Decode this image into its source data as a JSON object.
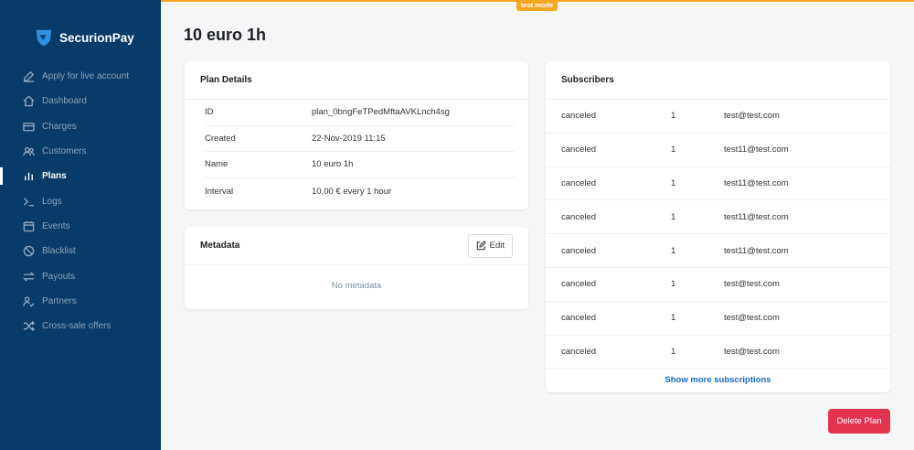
{
  "app": {
    "brand": "SecurionPay",
    "mode_badge": "test mode",
    "accent": "#f5a623",
    "sidebar_bg": "#063b6a"
  },
  "sidebar": {
    "items": [
      {
        "label": "Apply for live account",
        "icon": "edit-icon"
      },
      {
        "label": "Dashboard",
        "icon": "home-icon"
      },
      {
        "label": "Charges",
        "icon": "card-icon"
      },
      {
        "label": "Customers",
        "icon": "users-icon"
      },
      {
        "label": "Plans",
        "icon": "bars-icon",
        "active": true
      },
      {
        "label": "Logs",
        "icon": "terminal-icon"
      },
      {
        "label": "Events",
        "icon": "calendar-icon"
      },
      {
        "label": "Blacklist",
        "icon": "ban-icon"
      },
      {
        "label": "Payouts",
        "icon": "exchange-icon"
      },
      {
        "label": "Partners",
        "icon": "user-check-icon"
      },
      {
        "label": "Cross-sale offers",
        "icon": "shuffle-icon"
      }
    ]
  },
  "page": {
    "title": "10 euro 1h"
  },
  "plan_details": {
    "heading": "Plan Details",
    "rows": [
      {
        "label": "ID",
        "value": "plan_0bngFeTPedMftaAVKLnch4sg"
      },
      {
        "label": "Created",
        "value": "22-Nov-2019 11:15"
      },
      {
        "label": "Name",
        "value": "10 euro 1h"
      },
      {
        "label": "Interval",
        "value": "10,00 € every 1 hour"
      }
    ]
  },
  "metadata": {
    "heading": "Metadata",
    "edit_label": "Edit",
    "empty_text": "No metadata"
  },
  "subscribers": {
    "heading": "Subscribers",
    "rows": [
      {
        "status": "canceled",
        "qty": "1",
        "email": "test@test.com"
      },
      {
        "status": "canceled",
        "qty": "1",
        "email": "test11@test.com"
      },
      {
        "status": "canceled",
        "qty": "1",
        "email": "test11@test.com"
      },
      {
        "status": "canceled",
        "qty": "1",
        "email": "test11@test.com"
      },
      {
        "status": "canceled",
        "qty": "1",
        "email": "test11@test.com"
      },
      {
        "status": "canceled",
        "qty": "1",
        "email": "test@test.com"
      },
      {
        "status": "canceled",
        "qty": "1",
        "email": "test@test.com"
      },
      {
        "status": "canceled",
        "qty": "1",
        "email": "test@test.com"
      }
    ],
    "show_more_label": "Show more subscriptions"
  },
  "actions": {
    "delete_label": "Delete Plan",
    "delete_color": "#e2344f"
  }
}
